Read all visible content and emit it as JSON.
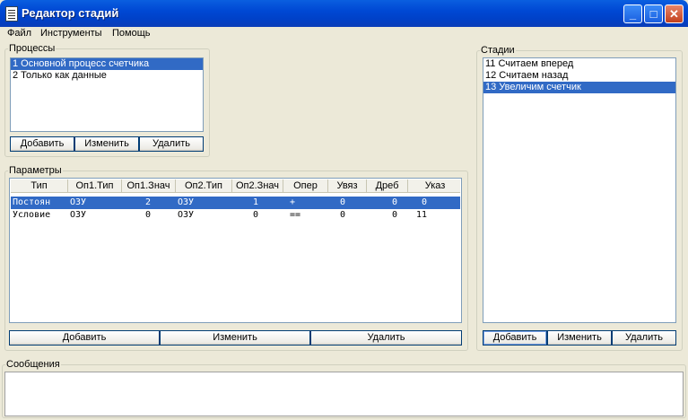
{
  "window": {
    "title": "Редактор стадий",
    "minimize": "_",
    "maximize": "□",
    "close": "✕"
  },
  "menu": [
    "Файл",
    "Инструменты",
    "Помощь"
  ],
  "processes": {
    "legend": "Процессы",
    "items": [
      "1 Основной процесс счетчика",
      "2 Только как данные"
    ],
    "selected": 0,
    "buttons": [
      "Добавить",
      "Изменить",
      "Удалить"
    ]
  },
  "params": {
    "legend": "Параметры",
    "columns": [
      "Тип",
      "Оп1.Тип",
      "Оп1.Знач",
      "Оп2.Тип",
      "Оп2.Знач",
      "Опер",
      "Увяз",
      "Дреб",
      "Указ"
    ],
    "rows": [
      [
        "Постоян",
        "ОЗУ",
        "2",
        "ОЗУ",
        "1",
        "+",
        "0",
        "0",
        "0"
      ],
      [
        "Условие",
        "ОЗУ",
        "0",
        "ОЗУ",
        "0",
        "==",
        "0",
        "0",
        "11"
      ]
    ],
    "selected": 0,
    "buttons": [
      "Добавить",
      "Изменить",
      "Удалить"
    ]
  },
  "stages": {
    "legend": "Стадии",
    "items": [
      "11 Считаем вперед",
      "12 Считаем назад",
      "13 Увеличим счетчик"
    ],
    "selected": 2,
    "buttons": [
      "Добавить",
      "Изменить",
      "Удалить"
    ]
  },
  "messages": {
    "legend": "Сообщения",
    "text": ""
  }
}
